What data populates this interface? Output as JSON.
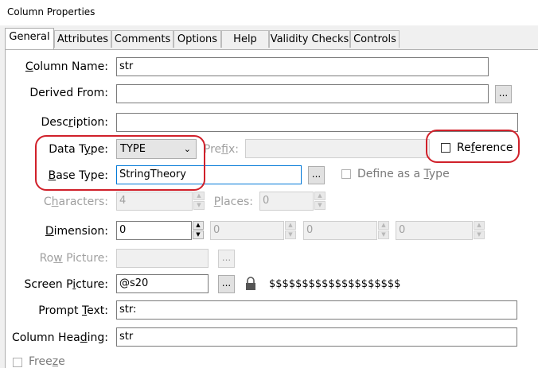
{
  "window": {
    "title": "Column Properties"
  },
  "tabs": [
    "General",
    "Attributes",
    "Comments",
    "Options",
    "Help",
    "Validity Checks",
    "Controls"
  ],
  "fields": {
    "column_name": {
      "label_pre": "",
      "label_key": "C",
      "label_post": "olumn Name:",
      "value": "str"
    },
    "derived_from": {
      "label_pre": "",
      "label_key": "",
      "label_post": "Derived From:",
      "value": "",
      "button": "..."
    },
    "description": {
      "label_pre": "Desc",
      "label_key": "r",
      "label_post": "iption:",
      "value": ""
    },
    "data_type": {
      "label_pre": "Data T",
      "label_key": "y",
      "label_post": "pe:",
      "value": "TYPE"
    },
    "prefix": {
      "label_pre": "Pre",
      "label_key": "f",
      "label_post": "ix:",
      "value": ""
    },
    "reference": {
      "label_pre": "Re",
      "label_key": "f",
      "label_post": "erence"
    },
    "base_type": {
      "label_pre": "",
      "label_key": "B",
      "label_post": "ase Type:",
      "value": "StringTheory",
      "button": "..."
    },
    "define_as_type": {
      "label_pre": "Define as a ",
      "label_key": "T",
      "label_post": "ype"
    },
    "characters": {
      "label_pre": "C",
      "label_key": "h",
      "label_post": "aracters:",
      "value": "4"
    },
    "places": {
      "label_pre": "",
      "label_key": "P",
      "label_post": "laces:",
      "value": "0"
    },
    "dimension": {
      "label_pre": "",
      "label_key": "D",
      "label_post": "imension:",
      "values": [
        "0",
        "0",
        "0",
        "0"
      ]
    },
    "row_picture": {
      "label_pre": "Ro",
      "label_key": "w",
      "label_post": " Picture:",
      "value": "",
      "button": "..."
    },
    "screen_picture": {
      "label_pre": "Screen P",
      "label_key": "i",
      "label_post": "cture:",
      "value": "@s20",
      "button": "...",
      "sample": "$$$$$$$$$$$$$$$$$$$$"
    },
    "prompt_text": {
      "label_pre": "Prompt ",
      "label_key": "T",
      "label_post": "ext:",
      "value": "str:"
    },
    "column_heading": {
      "label_pre": "Column Hea",
      "label_key": "d",
      "label_post": "ing:",
      "value": "str"
    },
    "freeze": {
      "label_pre": "Free",
      "label_key": "z",
      "label_post": "e"
    }
  },
  "colors": {
    "highlight": "#d0202a",
    "focus": "#0078d7"
  }
}
